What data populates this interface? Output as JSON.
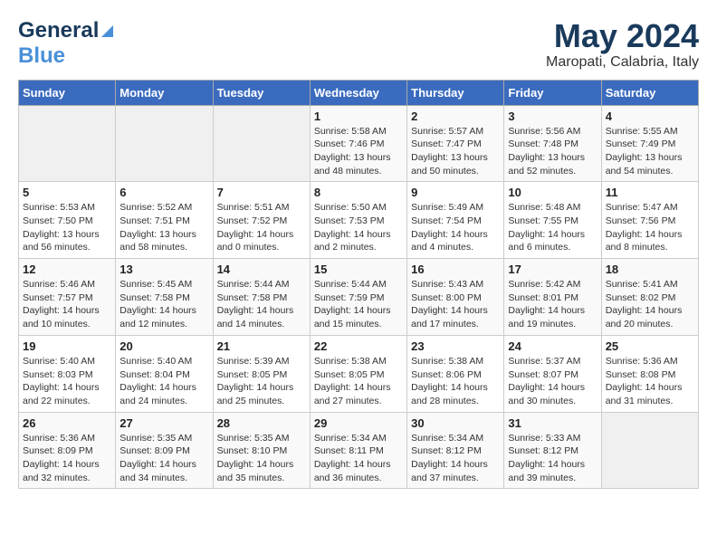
{
  "header": {
    "logo_line1": "General",
    "logo_line2": "Blue",
    "month": "May 2024",
    "location": "Maropati, Calabria, Italy"
  },
  "days_of_week": [
    "Sunday",
    "Monday",
    "Tuesday",
    "Wednesday",
    "Thursday",
    "Friday",
    "Saturday"
  ],
  "weeks": [
    [
      {
        "day": "",
        "info": ""
      },
      {
        "day": "",
        "info": ""
      },
      {
        "day": "",
        "info": ""
      },
      {
        "day": "1",
        "info": "Sunrise: 5:58 AM\nSunset: 7:46 PM\nDaylight: 13 hours\nand 48 minutes."
      },
      {
        "day": "2",
        "info": "Sunrise: 5:57 AM\nSunset: 7:47 PM\nDaylight: 13 hours\nand 50 minutes."
      },
      {
        "day": "3",
        "info": "Sunrise: 5:56 AM\nSunset: 7:48 PM\nDaylight: 13 hours\nand 52 minutes."
      },
      {
        "day": "4",
        "info": "Sunrise: 5:55 AM\nSunset: 7:49 PM\nDaylight: 13 hours\nand 54 minutes."
      }
    ],
    [
      {
        "day": "5",
        "info": "Sunrise: 5:53 AM\nSunset: 7:50 PM\nDaylight: 13 hours\nand 56 minutes."
      },
      {
        "day": "6",
        "info": "Sunrise: 5:52 AM\nSunset: 7:51 PM\nDaylight: 13 hours\nand 58 minutes."
      },
      {
        "day": "7",
        "info": "Sunrise: 5:51 AM\nSunset: 7:52 PM\nDaylight: 14 hours\nand 0 minutes."
      },
      {
        "day": "8",
        "info": "Sunrise: 5:50 AM\nSunset: 7:53 PM\nDaylight: 14 hours\nand 2 minutes."
      },
      {
        "day": "9",
        "info": "Sunrise: 5:49 AM\nSunset: 7:54 PM\nDaylight: 14 hours\nand 4 minutes."
      },
      {
        "day": "10",
        "info": "Sunrise: 5:48 AM\nSunset: 7:55 PM\nDaylight: 14 hours\nand 6 minutes."
      },
      {
        "day": "11",
        "info": "Sunrise: 5:47 AM\nSunset: 7:56 PM\nDaylight: 14 hours\nand 8 minutes."
      }
    ],
    [
      {
        "day": "12",
        "info": "Sunrise: 5:46 AM\nSunset: 7:57 PM\nDaylight: 14 hours\nand 10 minutes."
      },
      {
        "day": "13",
        "info": "Sunrise: 5:45 AM\nSunset: 7:58 PM\nDaylight: 14 hours\nand 12 minutes."
      },
      {
        "day": "14",
        "info": "Sunrise: 5:44 AM\nSunset: 7:58 PM\nDaylight: 14 hours\nand 14 minutes."
      },
      {
        "day": "15",
        "info": "Sunrise: 5:44 AM\nSunset: 7:59 PM\nDaylight: 14 hours\nand 15 minutes."
      },
      {
        "day": "16",
        "info": "Sunrise: 5:43 AM\nSunset: 8:00 PM\nDaylight: 14 hours\nand 17 minutes."
      },
      {
        "day": "17",
        "info": "Sunrise: 5:42 AM\nSunset: 8:01 PM\nDaylight: 14 hours\nand 19 minutes."
      },
      {
        "day": "18",
        "info": "Sunrise: 5:41 AM\nSunset: 8:02 PM\nDaylight: 14 hours\nand 20 minutes."
      }
    ],
    [
      {
        "day": "19",
        "info": "Sunrise: 5:40 AM\nSunset: 8:03 PM\nDaylight: 14 hours\nand 22 minutes."
      },
      {
        "day": "20",
        "info": "Sunrise: 5:40 AM\nSunset: 8:04 PM\nDaylight: 14 hours\nand 24 minutes."
      },
      {
        "day": "21",
        "info": "Sunrise: 5:39 AM\nSunset: 8:05 PM\nDaylight: 14 hours\nand 25 minutes."
      },
      {
        "day": "22",
        "info": "Sunrise: 5:38 AM\nSunset: 8:05 PM\nDaylight: 14 hours\nand 27 minutes."
      },
      {
        "day": "23",
        "info": "Sunrise: 5:38 AM\nSunset: 8:06 PM\nDaylight: 14 hours\nand 28 minutes."
      },
      {
        "day": "24",
        "info": "Sunrise: 5:37 AM\nSunset: 8:07 PM\nDaylight: 14 hours\nand 30 minutes."
      },
      {
        "day": "25",
        "info": "Sunrise: 5:36 AM\nSunset: 8:08 PM\nDaylight: 14 hours\nand 31 minutes."
      }
    ],
    [
      {
        "day": "26",
        "info": "Sunrise: 5:36 AM\nSunset: 8:09 PM\nDaylight: 14 hours\nand 32 minutes."
      },
      {
        "day": "27",
        "info": "Sunrise: 5:35 AM\nSunset: 8:09 PM\nDaylight: 14 hours\nand 34 minutes."
      },
      {
        "day": "28",
        "info": "Sunrise: 5:35 AM\nSunset: 8:10 PM\nDaylight: 14 hours\nand 35 minutes."
      },
      {
        "day": "29",
        "info": "Sunrise: 5:34 AM\nSunset: 8:11 PM\nDaylight: 14 hours\nand 36 minutes."
      },
      {
        "day": "30",
        "info": "Sunrise: 5:34 AM\nSunset: 8:12 PM\nDaylight: 14 hours\nand 37 minutes."
      },
      {
        "day": "31",
        "info": "Sunrise: 5:33 AM\nSunset: 8:12 PM\nDaylight: 14 hours\nand 39 minutes."
      },
      {
        "day": "",
        "info": ""
      }
    ]
  ]
}
